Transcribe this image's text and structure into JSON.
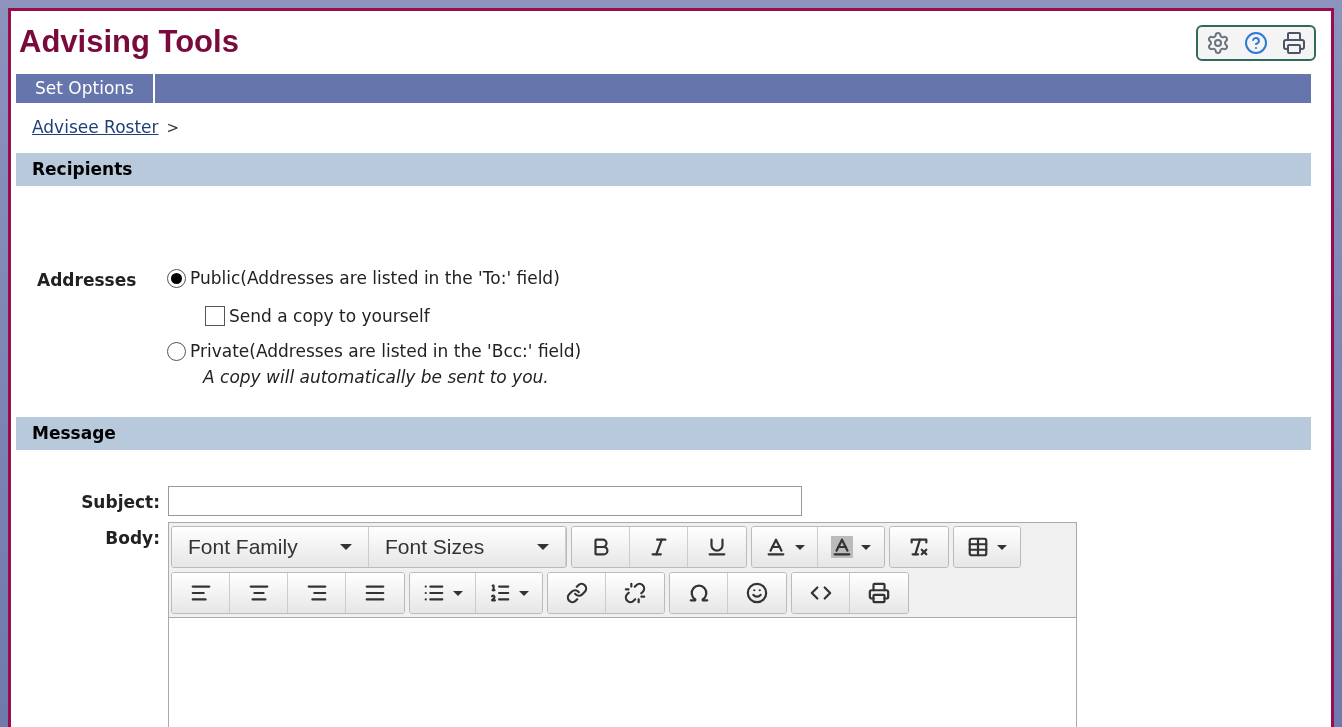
{
  "header": {
    "title": "Advising Tools",
    "tools": [
      {
        "kind": "settings"
      },
      {
        "kind": "help"
      },
      {
        "kind": "print"
      }
    ]
  },
  "menu_bar": {
    "items": [
      {
        "label": "Set Options"
      }
    ]
  },
  "breadcrumb": {
    "link": "Advisee Roster",
    "separator": ">"
  },
  "recipients": {
    "heading": "Recipients",
    "label": "Addresses",
    "options": [
      {
        "label": "Public(Addresses are listed in the 'To:' field)",
        "selected": true,
        "sub": {
          "label": "Send a copy to yourself",
          "checked": false
        }
      },
      {
        "label": "Private(Addresses are listed in the 'Bcc:' field)",
        "selected": false,
        "note": "A copy will automatically be sent to you."
      }
    ]
  },
  "message": {
    "heading": "Message",
    "subject_label": "Subject:",
    "body_label": "Body:",
    "toolbar_rows": [
      [
        [
          {
            "kind": "select",
            "label": "Font Family"
          },
          {
            "kind": "select",
            "label": "Font Sizes"
          }
        ],
        [
          {
            "kind": "bold"
          },
          {
            "kind": "italic"
          },
          {
            "kind": "underline"
          }
        ],
        [
          {
            "kind": "text-color",
            "dropdown": true
          },
          {
            "kind": "background-color",
            "dropdown": true
          }
        ],
        [
          {
            "kind": "clear-format"
          }
        ],
        [
          {
            "kind": "table",
            "dropdown": true
          }
        ]
      ],
      [
        [
          {
            "kind": "align-left"
          },
          {
            "kind": "align-center"
          },
          {
            "kind": "align-right"
          },
          {
            "kind": "justify"
          }
        ],
        [
          {
            "kind": "bullet-list",
            "dropdown": true
          },
          {
            "kind": "numbered-list",
            "dropdown": true
          }
        ],
        [
          {
            "kind": "link"
          },
          {
            "kind": "unlink"
          }
        ],
        [
          {
            "kind": "special-character"
          },
          {
            "kind": "emoticon"
          }
        ],
        [
          {
            "kind": "source-code"
          },
          {
            "kind": "print"
          }
        ]
      ]
    ]
  }
}
